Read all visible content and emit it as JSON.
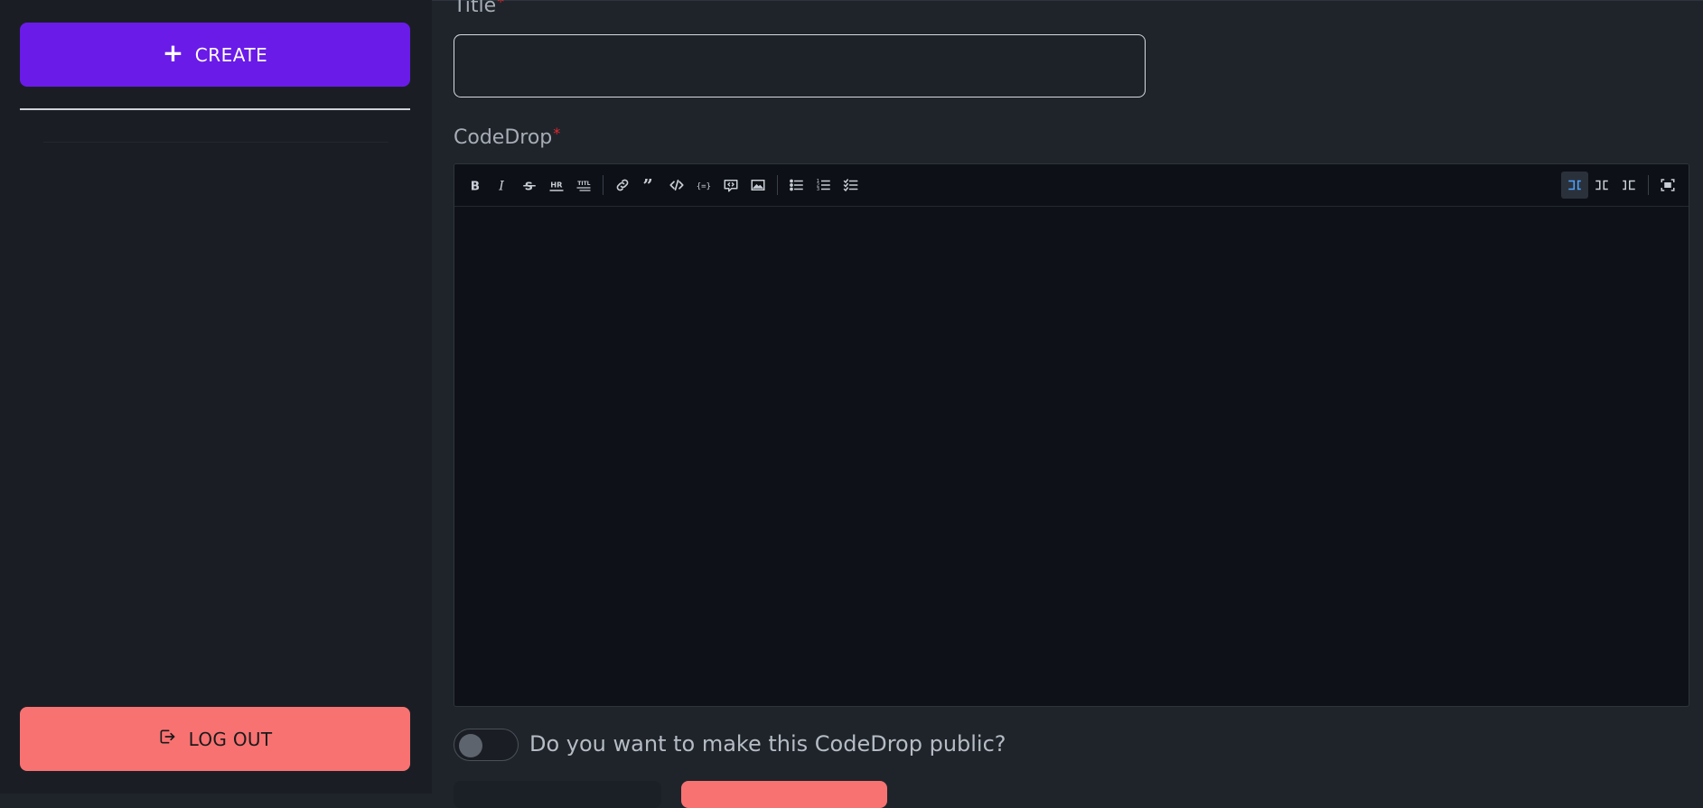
{
  "sidebar": {
    "create_label": "CREATE",
    "logout_label": "LOG OUT"
  },
  "form": {
    "title_label": "Title",
    "title_required": "*",
    "title_value": "",
    "codedrop_label": "CodeDrop",
    "codedrop_required": "*",
    "public_toggle_label": "Do you want to make this CodeDrop public?",
    "public_toggle_on": false
  },
  "editor": {
    "toolbar_icons": [
      "bold-icon",
      "italic-icon",
      "strikethrough-icon",
      "hr-icon",
      "title-icon",
      "link-icon",
      "quote-icon",
      "code-icon",
      "code-block-icon",
      "comment-icon",
      "image-icon",
      "unordered-list-icon",
      "ordered-list-icon",
      "checked-list-icon",
      "edit-mode-icon",
      "live-mode-icon",
      "preview-mode-icon",
      "fullscreen-icon"
    ],
    "active_mode": "edit"
  },
  "colors": {
    "accent": "#6a1be8",
    "danger": "#f87272",
    "required": "#e0292e",
    "active_mode_icon": "#4aa3ff"
  }
}
